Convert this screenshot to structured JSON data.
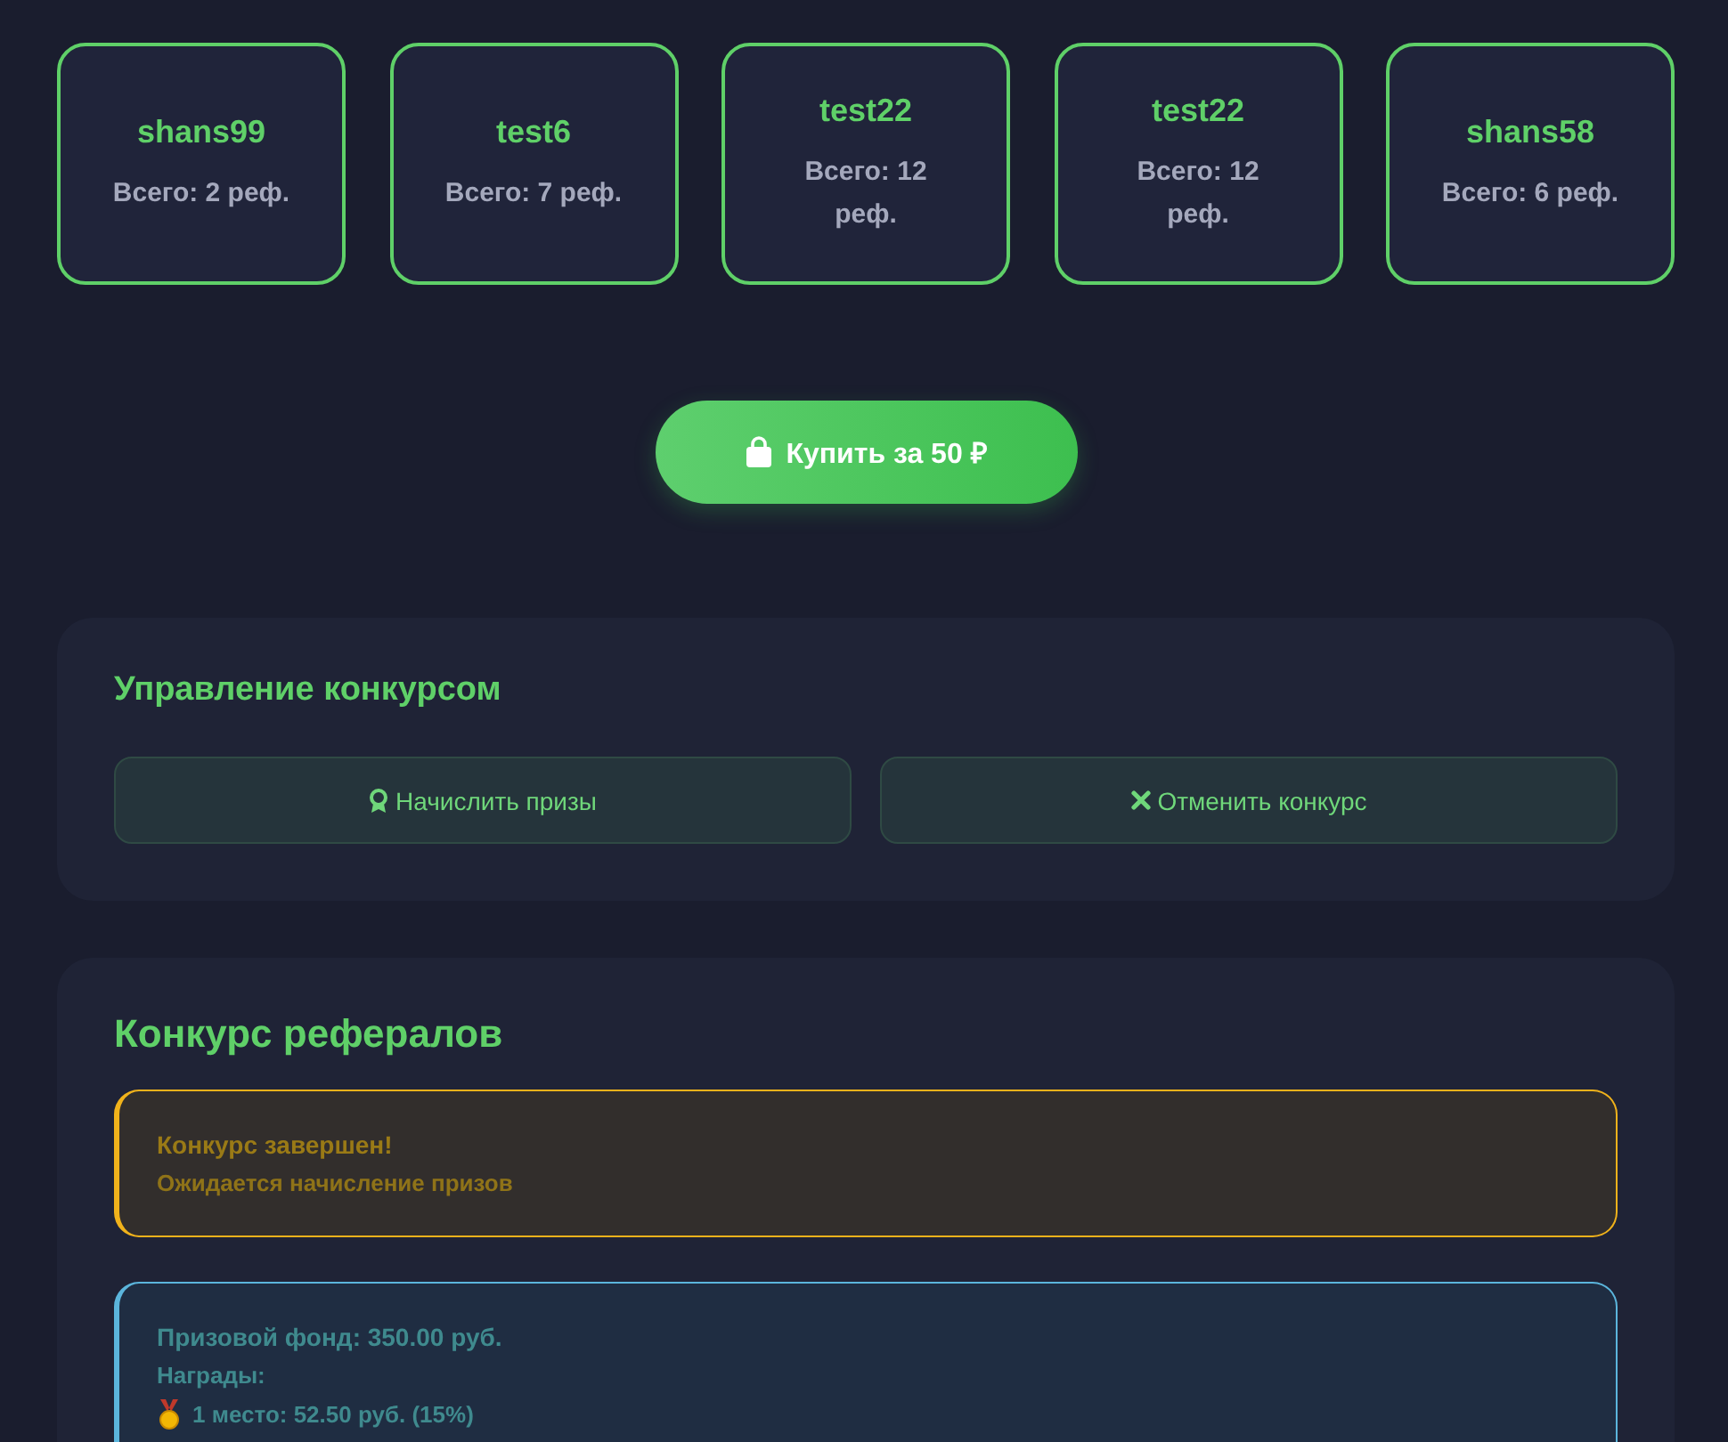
{
  "top_referrers": [
    {
      "name": "shans99",
      "total": "Всего: 2 реф."
    },
    {
      "name": "test6",
      "total": "Всего: 7 реф."
    },
    {
      "name": "test22",
      "total": "Всего: 12 реф."
    },
    {
      "name": "test22",
      "total": "Всего: 12 реф."
    },
    {
      "name": "shans58",
      "total": "Всего: 6 реф."
    }
  ],
  "buy_button": {
    "label": "Купить за 50 ₽"
  },
  "management": {
    "title": "Управление конкурсом",
    "buttons": [
      {
        "kind": "award",
        "label": "Начислить призы"
      },
      {
        "kind": "cancel",
        "label": "Отменить конкурс"
      }
    ]
  },
  "contest": {
    "title": "Конкурс рефералов",
    "status": {
      "title": "Конкурс завершен!",
      "text": "Ожидается начисление призов"
    },
    "prize_pool": {
      "title": "Призовой фонд: 350.00 руб.",
      "rewards_label": "Награды:",
      "rewards": [
        {
          "kind": "gold",
          "text": "1 место: 52.50 руб. (15%)"
        }
      ]
    }
  }
}
